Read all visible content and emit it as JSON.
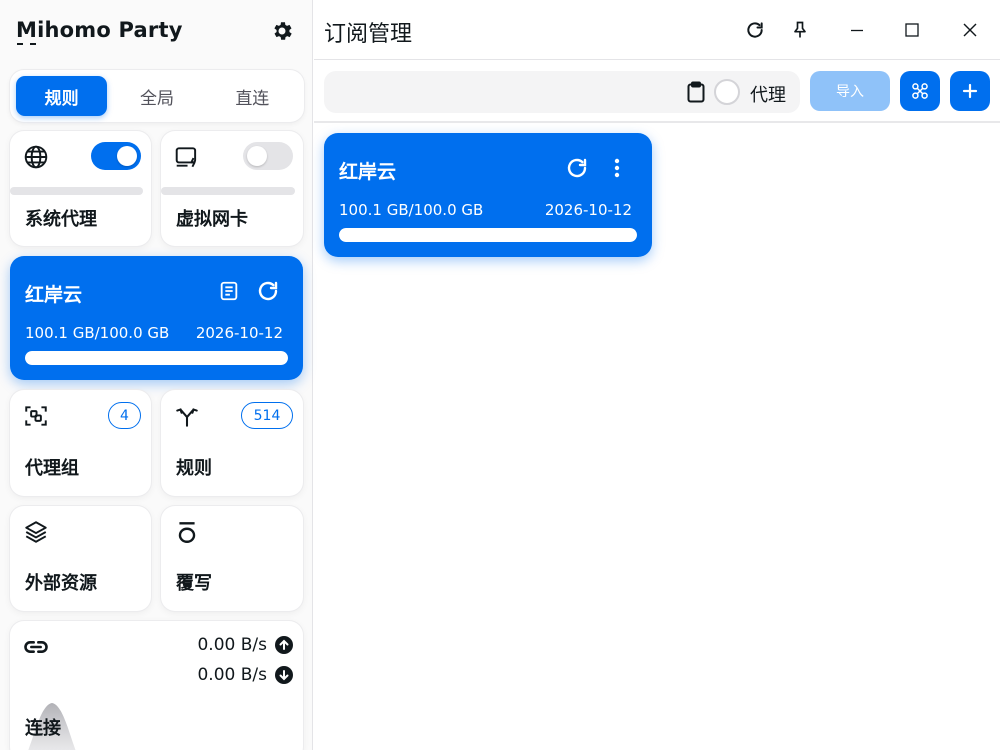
{
  "app": {
    "brand": "Mihomo Party",
    "brand_first": "M",
    "brand_rest": "ihomo Party"
  },
  "sidebar": {
    "modes": [
      {
        "label": "规则",
        "active": true
      },
      {
        "label": "全局",
        "active": false
      },
      {
        "label": "直连",
        "active": false
      }
    ],
    "system_proxy": {
      "label": "系统代理",
      "enabled": true,
      "icon": "globe-icon"
    },
    "tun": {
      "label": "虚拟网卡",
      "enabled": false,
      "icon": "network-card-icon"
    },
    "subscription": {
      "name": "红岸云",
      "traffic": "100.1 GB/100.0 GB",
      "date": "2026-10-12",
      "usage": 1.0
    },
    "proxy_groups": {
      "label": "代理组",
      "count": "4",
      "icon": "proxy-group-icon"
    },
    "rules": {
      "label": "规则",
      "count": "514",
      "icon": "fork-icon"
    },
    "external_resources": {
      "label": "外部资源",
      "icon": "layers-icon"
    },
    "override": {
      "label": "覆写",
      "icon": "override-icon"
    },
    "connections": {
      "label": "连接",
      "upload": "0.00 B/s",
      "download": "0.00 B/s",
      "icon": "link-icon"
    }
  },
  "main": {
    "title": "订阅管理",
    "toolbar": {
      "url_value": "",
      "url_placeholder": "",
      "proxy_label": "代理",
      "import_label": "导入"
    },
    "profiles": [
      {
        "name": "红岸云",
        "traffic": "100.1 GB/100.0 GB",
        "date": "2026-10-12",
        "usage": 1.0
      }
    ]
  },
  "colors": {
    "accent": "#006fee",
    "accent_disabled": "#8fc2f9",
    "track": "#e4e4e7"
  }
}
